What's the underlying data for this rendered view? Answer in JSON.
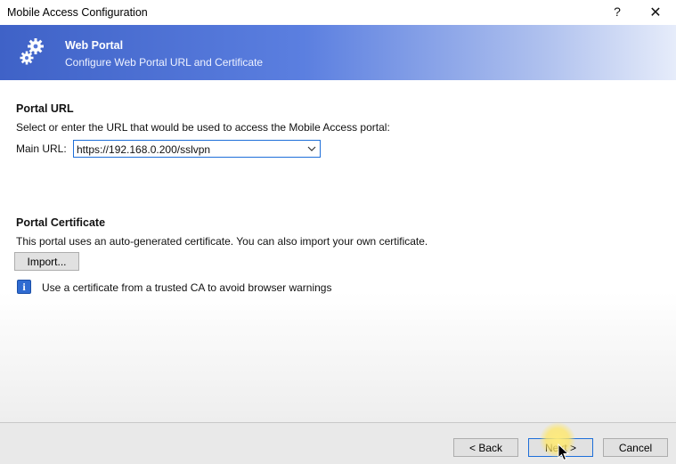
{
  "window": {
    "title": "Mobile Access Configuration",
    "help_label": "?",
    "close_label": "✕"
  },
  "banner": {
    "title": "Web Portal",
    "subtitle": "Configure Web Portal URL and Certificate",
    "icon": "gears-icon"
  },
  "portal_url": {
    "heading": "Portal URL",
    "description": "Select or enter the URL that would be used to access the Mobile Access portal:",
    "label": "Main URL:",
    "value": "https://192.168.0.200/sslvpn"
  },
  "portal_certificate": {
    "heading": "Portal Certificate",
    "description": "This portal uses an auto-generated certificate. You can also import your own certificate.",
    "import_label": "Import...",
    "info_text": "Use a certificate from a trusted CA to avoid browser warnings"
  },
  "footer": {
    "back_label": "< Back",
    "next_label": "Next >",
    "cancel_label": "Cancel"
  },
  "colors": {
    "accent": "#1e6fd9",
    "banner_start": "#3f62c7",
    "info": "#2f6bd1"
  }
}
